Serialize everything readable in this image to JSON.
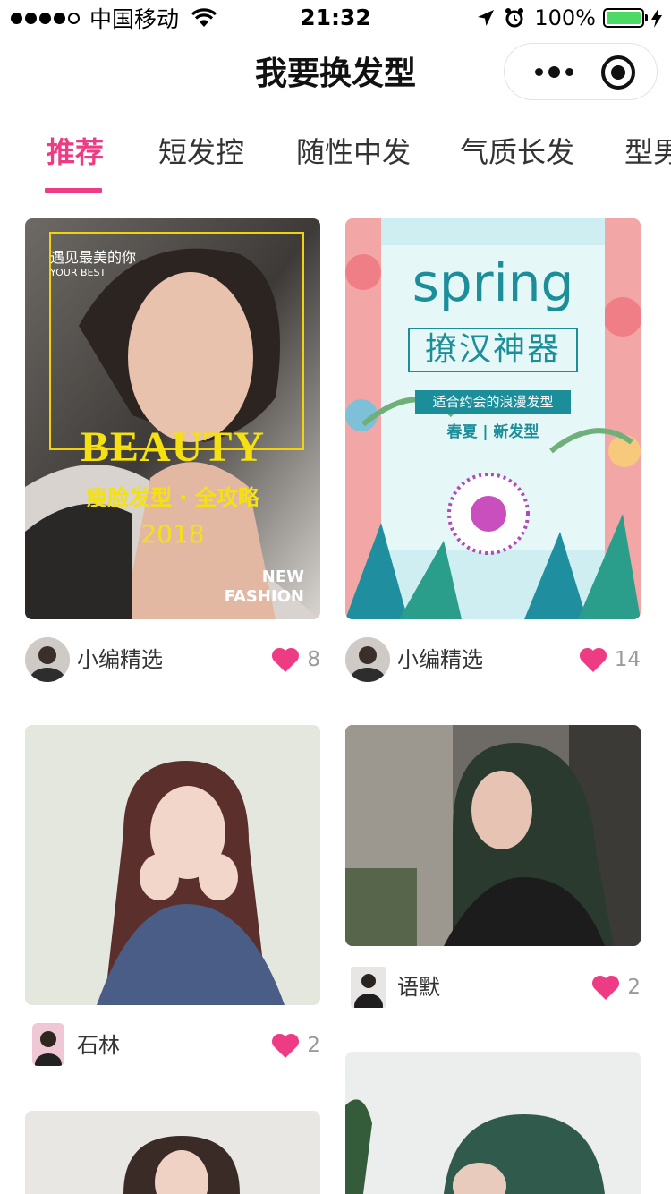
{
  "status_bar": {
    "carrier": "中国移动",
    "time": "21:32",
    "battery_pct": "100%",
    "battery_level": 1.0,
    "signal_bars": 4
  },
  "nav": {
    "title": "我要换发型"
  },
  "tabs": [
    {
      "label": "推荐",
      "active": true
    },
    {
      "label": "短发控",
      "active": false
    },
    {
      "label": "随性中发",
      "active": false
    },
    {
      "label": "气质长发",
      "active": false
    },
    {
      "label": "型男",
      "active": false
    }
  ],
  "colors": {
    "accent": "#ee3c84",
    "heart": "#ee3c84",
    "battery": "#4cd964"
  },
  "cards": [
    {
      "author": "小编精选",
      "likes": "8",
      "poster": {
        "tag_cn": "遇见最美的你",
        "tag_en": "YOUR BEST",
        "headline": "BEAUTY",
        "subtitle": "瘦脸发型 · 全攻略",
        "year": "2018",
        "badge_1": "NEW",
        "badge_2": "FASHION"
      }
    },
    {
      "author": "小编精选",
      "likes": "14",
      "poster": {
        "headline": "spring",
        "title": "撩汉神器",
        "banner": "适合约会的浪漫发型",
        "line": "春夏 | 新发型"
      }
    },
    {
      "author": "石林",
      "likes": "2"
    },
    {
      "author": "语默",
      "likes": "2"
    },
    {
      "author": "",
      "likes": ""
    },
    {
      "author": "",
      "likes": ""
    }
  ]
}
